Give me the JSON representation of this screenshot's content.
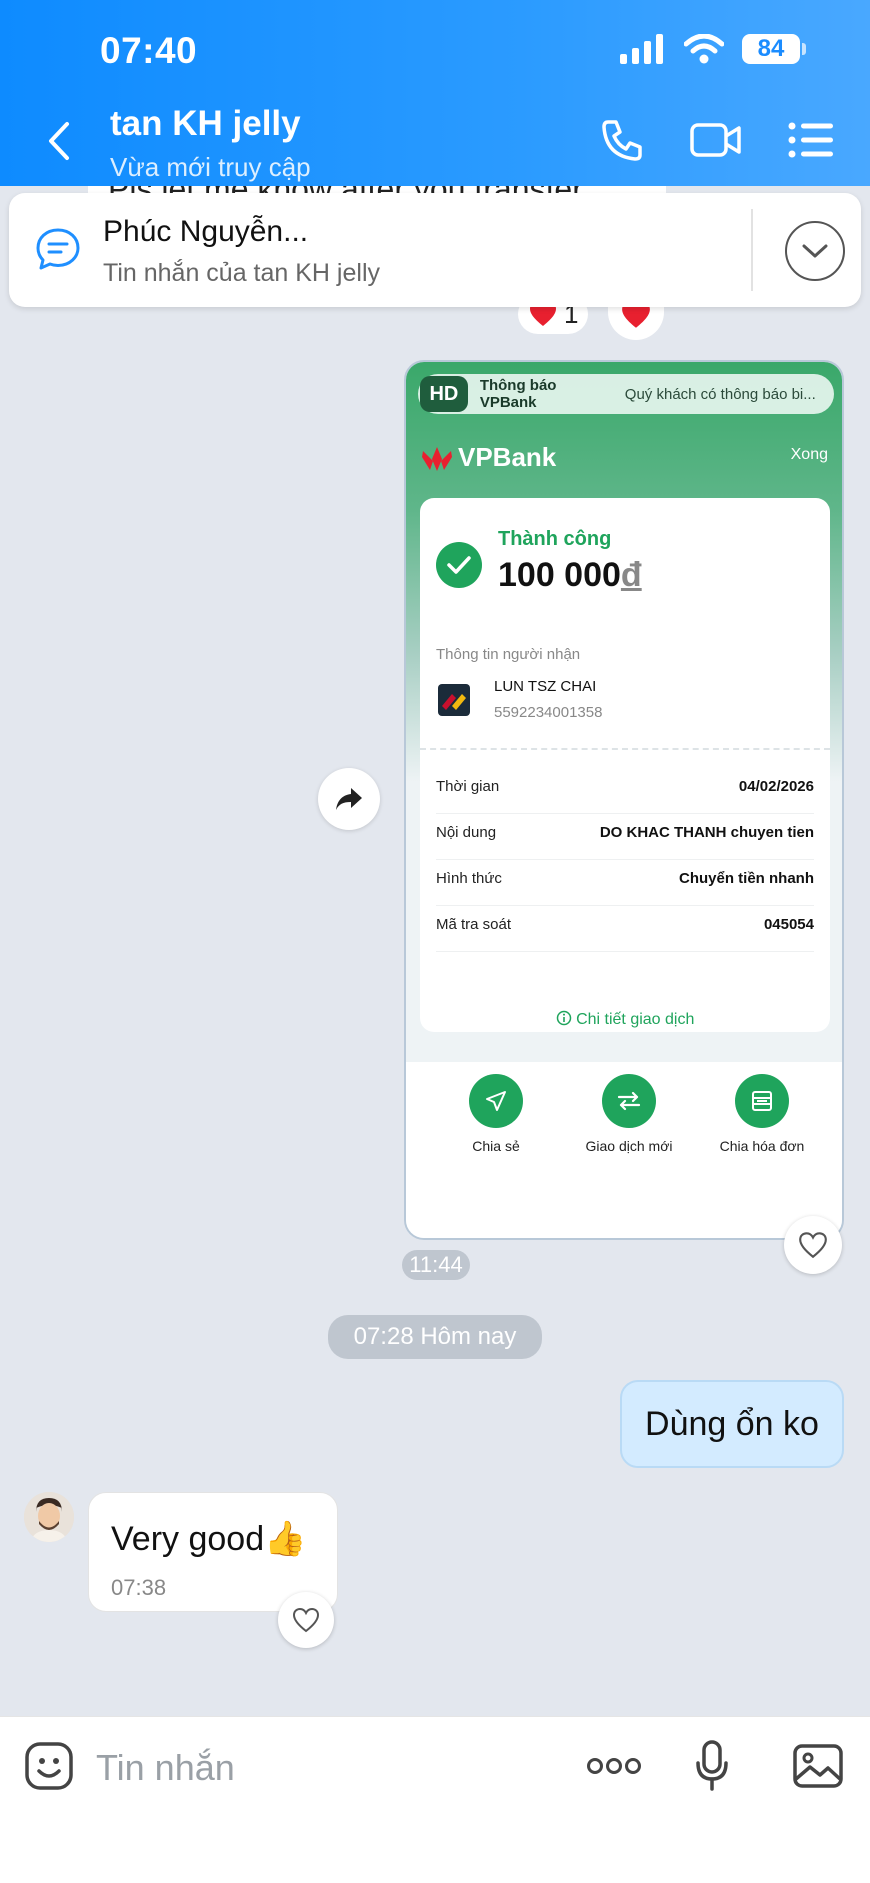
{
  "status_bar": {
    "time": "07:40",
    "battery": "84"
  },
  "header": {
    "title": "tan KH jelly",
    "subtitle": "Vừa mới truy cập"
  },
  "quoted_text": "Pls let me know after you transfer",
  "pinned": {
    "name": "Phúc Nguyễn...",
    "subtitle": "Tin nhắn của tan KH jelly"
  },
  "reactions": {
    "heart_count": "1"
  },
  "screenshot": {
    "notification": {
      "badge": "HD",
      "title": "Thông báo VPBank",
      "body": "Quý khách có thông báo bi..."
    },
    "logo_text": "VPBank",
    "done_label": "Xong",
    "status": "Thành công",
    "amount": "100 000",
    "currency": "đ",
    "recipient_label": "Thông tin người nhận",
    "recipient_name": "LUN TSZ CHAI",
    "recipient_account": "5592234001358",
    "rows": [
      {
        "label": "Thời gian",
        "value": "04/02/2026"
      },
      {
        "label": "Nội dung",
        "value": "DO KHAC THANH chuyen tien"
      },
      {
        "label": "Hình thức",
        "value": "Chuyển tiền nhanh"
      },
      {
        "label": "Mã tra soát",
        "value": "045054"
      }
    ],
    "detail_link": "Chi tiết giao dịch",
    "actions": [
      "Chia sẻ",
      "Giao dịch mới",
      "Chia hóa đơn"
    ]
  },
  "message_time": "11:44",
  "date_divider": "07:28 Hôm nay",
  "outgoing": {
    "text": "Dùng ổn ko"
  },
  "incoming": {
    "text": "Very good👍",
    "time": "07:38"
  },
  "input": {
    "placeholder": "Tin nhắn"
  },
  "colors": {
    "header_blue": "#0e8bff",
    "vp_green": "#1fa45c",
    "bubble_blue": "#d3ebff"
  }
}
